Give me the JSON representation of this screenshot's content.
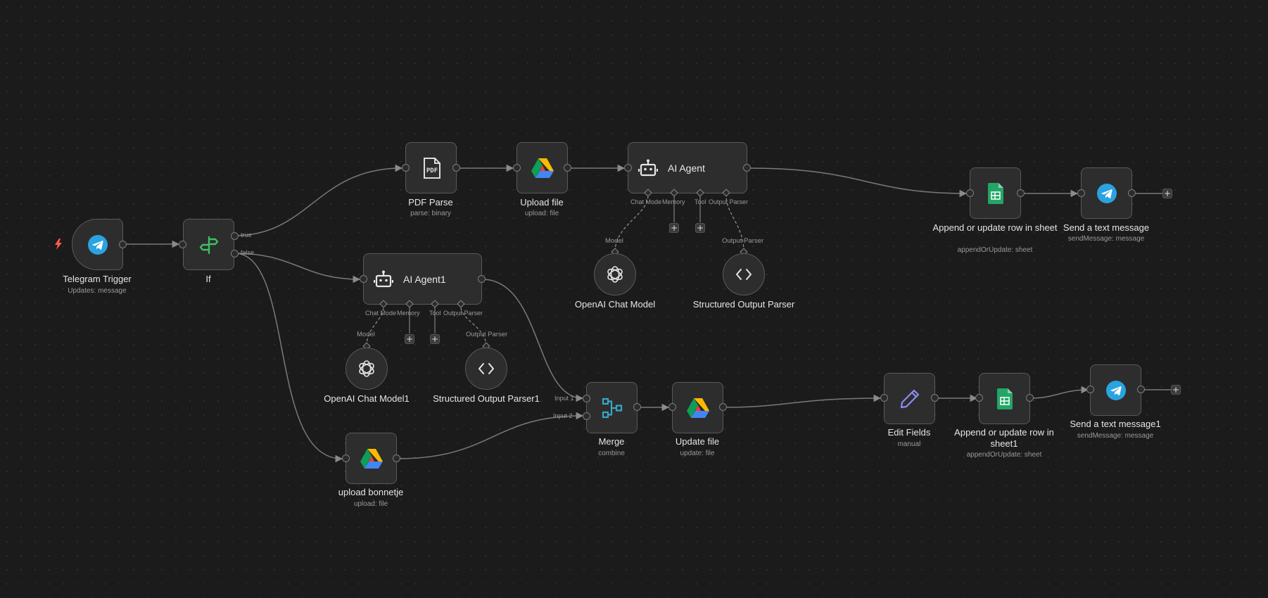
{
  "canvas": {
    "background": "#1b1b1b",
    "accent_colors": {
      "telegram": "#2aa3e0",
      "sheets_green": "#23a566",
      "if_green": "#3fbf62",
      "merge_blue": "#3aa6c7",
      "edit_purple": "#8b8cf2",
      "trigger_bolt": "#ff5a4e"
    }
  },
  "nodes": {
    "telegram_trigger": {
      "title": "Telegram Trigger",
      "subtitle": "Updates: message",
      "icon": "telegram-icon"
    },
    "if": {
      "title": "If",
      "icon": "signpost-icon",
      "out_true": "true",
      "out_false": "false"
    },
    "pdf_parse": {
      "title": "PDF Parse",
      "subtitle": "parse: binary",
      "icon": "pdf-file-icon",
      "icon_text": "PDF"
    },
    "upload_file": {
      "title": "Upload file",
      "subtitle": "upload: file",
      "icon": "google-drive-icon"
    },
    "ai_agent": {
      "title": "AI Agent",
      "icon": "robot-icon",
      "ports": [
        "Chat Mode",
        "Memory",
        "Tool",
        "Output Parser"
      ]
    },
    "append_row": {
      "title": "Append or update row in sheet",
      "subtitle": "appendOrUpdate: sheet",
      "icon": "google-sheets-icon"
    },
    "send_message": {
      "title": "Send a text message",
      "subtitle": "sendMessage: message",
      "icon": "telegram-icon"
    },
    "openai_chat_model": {
      "title": "OpenAI Chat Model",
      "port_label": "Model",
      "icon": "openai-icon"
    },
    "structured_output_parser": {
      "title": "Structured Output Parser",
      "port_label": "Output Parser",
      "icon": "code-brackets-icon"
    },
    "ai_agent1": {
      "title": "AI Agent1",
      "icon": "robot-icon",
      "ports": [
        "Chat Mode",
        "Memory",
        "Tool",
        "Output Parser"
      ]
    },
    "openai_chat_model1": {
      "title": "OpenAI Chat Model1",
      "port_label": "Model",
      "icon": "openai-icon"
    },
    "structured_output_parser1": {
      "title": "Structured Output Parser1",
      "port_label": "Output Parser",
      "icon": "code-brackets-icon"
    },
    "merge": {
      "title": "Merge",
      "subtitle": "combine",
      "icon": "merge-icon",
      "input1": "Input 1",
      "input2": "Input 2"
    },
    "update_file": {
      "title": "Update file",
      "subtitle": "update: file",
      "icon": "google-drive-icon"
    },
    "edit_fields": {
      "title": "Edit Fields",
      "subtitle": "manual",
      "icon": "pencil-icon"
    },
    "append_row1": {
      "title": "Append or update row in sheet1",
      "subtitle": "appendOrUpdate: sheet",
      "icon": "google-sheets-icon"
    },
    "send_message1": {
      "title": "Send a text message1",
      "subtitle": "sendMessage: message",
      "icon": "telegram-icon"
    },
    "upload_bonnetje": {
      "title": "upload bonnetje",
      "subtitle": "upload: file",
      "icon": "google-drive-icon"
    }
  },
  "plus_label": "+"
}
